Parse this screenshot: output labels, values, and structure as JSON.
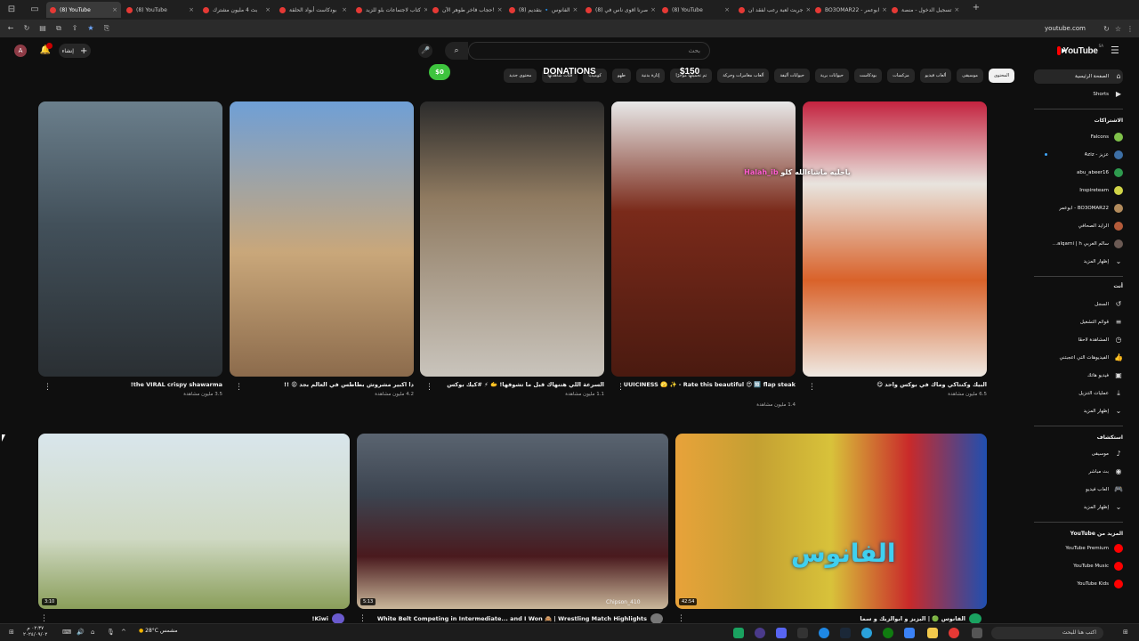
{
  "browser": {
    "tabs": [
      {
        "title": "(8) YouTube",
        "active": true
      },
      {
        "title": "(8) YouTube",
        "active": false
      },
      {
        "title": "بث 4 مليون مشترك",
        "active": false
      },
      {
        "title": "بودكاست أبواد الحلقة",
        "active": false
      },
      {
        "title": "كتاب لاجتماعات بلو للزيد",
        "active": false
      },
      {
        "title": "حجاب فاخر طوهر الآن!",
        "active": false
      },
      {
        "title": "(8) الفانوس 🔹 بتقديم",
        "active": false
      },
      {
        "title": "(8) صرنا اقوى ناس في",
        "active": false
      },
      {
        "title": "(8) YouTube",
        "active": false
      },
      {
        "title": "جربت لعبة رعب لفقد ان",
        "active": false
      },
      {
        "title": "BO3OMAR22 - ابوعمر",
        "active": false
      },
      {
        "title": "تسجيل الدخول - منصة",
        "active": false
      }
    ],
    "url": "youtube.com"
  },
  "header": {
    "logo_text": "YouTube",
    "logo_sup": "SA",
    "search_placeholder": "بحث",
    "create_label": "إنشاء",
    "avatar_letter": "A"
  },
  "donation": {
    "current": "$0",
    "title": "DONATIONS",
    "goal": "$150"
  },
  "chips": [
    {
      "label": "المحتوى",
      "active": true
    },
    {
      "label": "موسيقى",
      "active": false
    },
    {
      "label": "ألعاب فيديو",
      "active": false
    },
    {
      "label": "مزكسات",
      "active": false
    },
    {
      "label": "بودكاست",
      "active": false
    },
    {
      "label": "حيوانات برية",
      "active": false
    },
    {
      "label": "حيوانات أليفة",
      "active": false
    },
    {
      "label": "ألعاب مغامرات وحركة",
      "active": false
    },
    {
      "label": "تم تحميلها مؤخرًا",
      "active": false
    },
    {
      "label": "إثارة بدنية",
      "active": false
    },
    {
      "label": "طهو",
      "active": false
    },
    {
      "label": "كوميديا",
      "active": false
    },
    {
      "label": "فئات شاهدتها",
      "active": false
    },
    {
      "label": "محتوى جديد",
      "active": false
    }
  ],
  "sidebar": {
    "main": [
      {
        "label": "الصفحة الرئيسية",
        "icon": "home-icon",
        "active": true
      },
      {
        "label": "Shorts",
        "icon": "shorts-icon",
        "active": false
      }
    ],
    "subscriptions_heading": "الاشتراكات",
    "subscriptions": [
      {
        "label": "Falcons",
        "color": "#7fc14a"
      },
      {
        "label": "عزيز - Aziz",
        "color": "#3d6fa5",
        "dot": true
      },
      {
        "label": "abu_abeer16",
        "color": "#2e9a4e"
      },
      {
        "label": "Inspireteam",
        "color": "#d0d447"
      },
      {
        "label": "BO3OMAR22 - ابوعمر",
        "color": "#b28b5c"
      },
      {
        "label": "الرايد الصحافي",
        "color": "#b45b3a"
      },
      {
        "label": "سالم الغربي alqarni | h...",
        "color": "#6b5a54"
      },
      {
        "label": "إظهار المزيد",
        "icon": "chevron-down-icon"
      }
    ],
    "you_heading": "أنت",
    "you": [
      {
        "label": "السجل",
        "icon": "history-icon"
      },
      {
        "label": "قوائم التشغيل",
        "icon": "playlist-icon"
      },
      {
        "label": "المشاهدة لاحقًا",
        "icon": "clock-icon"
      },
      {
        "label": "الفيديوهات التي أعجبتني",
        "icon": "like-icon"
      },
      {
        "label": "فيديو هاتك",
        "icon": "your-videos-icon"
      },
      {
        "label": "عمليات التنزيل",
        "icon": "download-icon"
      },
      {
        "label": "إظهار المزيد",
        "icon": "chevron-down-icon"
      }
    ],
    "explore_heading": "استكشاف",
    "explore": [
      {
        "label": "موسيقى",
        "icon": "music-icon"
      },
      {
        "label": "بث مباشر",
        "icon": "live-icon"
      },
      {
        "label": "ألعاب فيديو",
        "icon": "gaming-icon"
      },
      {
        "label": "إظهار المزيد",
        "icon": "chevron-down-icon"
      }
    ],
    "more_heading": "المزيد من YouTube",
    "more": [
      {
        "label": "YouTube Premium",
        "color": "#ff0000"
      },
      {
        "label": "YouTube Music",
        "color": "#ff0000"
      },
      {
        "label": "YouTube Kids",
        "color": "#ff0000"
      }
    ]
  },
  "shorts": [
    {
      "title": "the VIRAL crispy shawarma!",
      "views": "3.5 مليون مشاهدة",
      "bg": "linear-gradient(180deg,#6b7f8c 0%,#42505a 45%,#2a2f33 100%)"
    },
    {
      "title": "دا اكبير مشروش بطاطس في العالم بجد 😩 !!",
      "views": "4.2 مليون مشاهدة",
      "bg": "linear-gradient(180deg,#6f9fd6 0%,#c9a77a 55%,#8c6b4c 100%)"
    },
    {
      "title": "السرعة اللي هتنهاك قبل ما تشوفها! 🫱 ⚡ #كيك بوكس",
      "views": "1.1 مليون مشاهدة",
      "bg": "linear-gradient(180deg,#2b2b2b 0%,#8f7a60 35%,#c9c4bc 100%)"
    },
    {
      "title": "Oh my JUUUICINESS 🫣 ✨ - Rate this beautiful 😍 🔟 flap steak",
      "views": "1.4 مليون مشاهدة",
      "bg": "linear-gradient(180deg,#e8e8e8 0%,#7a2a1a 40%,#4a1a10 100%)"
    },
    {
      "title": "البيك وكنتاكي وماك في بوكس واحد 😋",
      "views": "6.5 مليون مشاهدة",
      "bg": "linear-gradient(180deg,#c4233f 0%,#e8e4de 30%,#d9622a 65%,#efe9e2 100%)"
    }
  ],
  "shorts_overlay": {
    "username": "Halah_ib",
    "caption": "ياحليه ماشاءالله كلو"
  },
  "videos": [
    {
      "title": "Kiwi!",
      "duration": "3:10",
      "bg": "linear-gradient(180deg,#d9e6ec 0%,#cfd9c3 60%,#8a9e5a 100%)"
    },
    {
      "title": "White Belt Competing in Intermediate... and I Won 🙈 | Wrestling Match Highlights",
      "duration": "5:13",
      "bg": "linear-gradient(180deg,#5a6470 0%,#3c4450 35%,#4a1a1e 70%,#c9b79a 100%)",
      "overlay": "Chipson_410"
    },
    {
      "title": "الفانوس 🟢 | البزيز و ابوالزيك و سما",
      "duration": "42:54",
      "bg": "linear-gradient(90deg,#e8a23a 0%,#c4a032 26%,#d8c23a 50%,#c92a2a 75%,#1f4fb0 100%)",
      "overlay": "الفانوس"
    }
  ],
  "taskbar": {
    "search": "اكتب هنا للبحث",
    "weather": "28°C مشمس",
    "time": "٠٢:٣٧ م",
    "date": "٢٠٢٤/٠٩/٠٢"
  }
}
